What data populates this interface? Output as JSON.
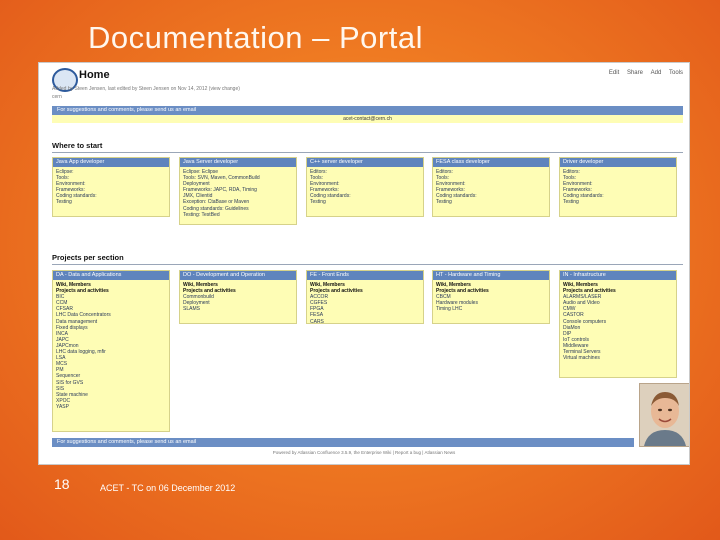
{
  "slide": {
    "title": "Documentation – Portal",
    "number": "18",
    "caption": "ACET - TC on 06 December 2012"
  },
  "page": {
    "title": "Home",
    "toolbar": [
      "Edit",
      "Share",
      "Add",
      "Tools"
    ],
    "byline": "Added by Steen Jensen, last edited by Steen Jensen on Nov 14, 2012 (view change)",
    "org": "cern",
    "suggestion_text": "For suggestions and comments, please send us an email",
    "email": "acet-contact@cern.ch",
    "where_title": "Where to start",
    "projects_title": "Projects per section",
    "footer": "Powered by Atlassian Confluence 3.5.9, the Enterprise Wiki | Report a bug | Atlassian News"
  },
  "where": [
    {
      "title": "Java App developer",
      "items": [
        "Eclipse:",
        "Tools:",
        "Environment:",
        "Frameworks:",
        "Coding standards:",
        "Testing"
      ]
    },
    {
      "title": "Java Server developer",
      "items": [
        "Eclipse: Eclipse",
        "Tools: SVN, Maven, CommonBuild",
        "Deployment",
        "Frameworks: JAPC, RDA, Timing",
        "JMX, Clientid",
        "Exception: CtaBase or Maven",
        "Coding standards: Guidelines",
        "Testing: TestBed"
      ]
    },
    {
      "title": "C++ server developer",
      "items": [
        "Editors:",
        "Tools:",
        "Environment:",
        "Frameworks:",
        "Coding standards:",
        "Testing"
      ]
    },
    {
      "title": "FESA class developer",
      "items": [
        "Editors:",
        "Tools:",
        "Environment:",
        "Frameworks:",
        "Coding standards:",
        "Testing"
      ]
    },
    {
      "title": "Driver developer",
      "items": [
        "Editors:",
        "Tools:",
        "Environment:",
        "Frameworks:",
        "Coding standards:",
        "Testing"
      ]
    }
  ],
  "projects": [
    {
      "title": "DA - Data and Applications",
      "items": [
        "Wiki, Members",
        "Projects and activities",
        "BIC",
        "CCM",
        "CFSAR",
        "LHC Data Concentrators",
        "Data management",
        "Fixed displays",
        "INCA",
        "JAPC",
        "JAPCmon",
        "LHC data logging, mfir",
        "LSA",
        "MCS",
        "PM",
        "Sequencer",
        "SIS for GVS",
        "SIS",
        "State machine",
        "XPOC",
        "YASP"
      ]
    },
    {
      "title": "DO - Development and Operation",
      "items": [
        "Wiki, Members",
        "Projects and activities",
        "Commonbuild",
        "Deployment",
        "SLAMS"
      ]
    },
    {
      "title": "FE - Front Ends",
      "items": [
        "Wiki, Members",
        "Projects and activities",
        "ACCOR",
        "CGFES",
        "FPGA",
        "FESA",
        "CARS"
      ]
    },
    {
      "title": "HT - Hardware and Timing",
      "items": [
        "Wiki, Members",
        "Projects and activities",
        "CBCM",
        "Hardware modules",
        "Timing LHC"
      ]
    },
    {
      "title": "IN - Infrastructure",
      "items": [
        "Wiki, Members",
        "Projects and activities",
        "ALARMS/LASER",
        "Audio and Video",
        "CMW",
        "CASTOR",
        "Console computers",
        "DiaMon",
        "DIP",
        "IoT controls",
        "Middleware",
        "Terminal Servers",
        "Virtual machines"
      ]
    }
  ]
}
